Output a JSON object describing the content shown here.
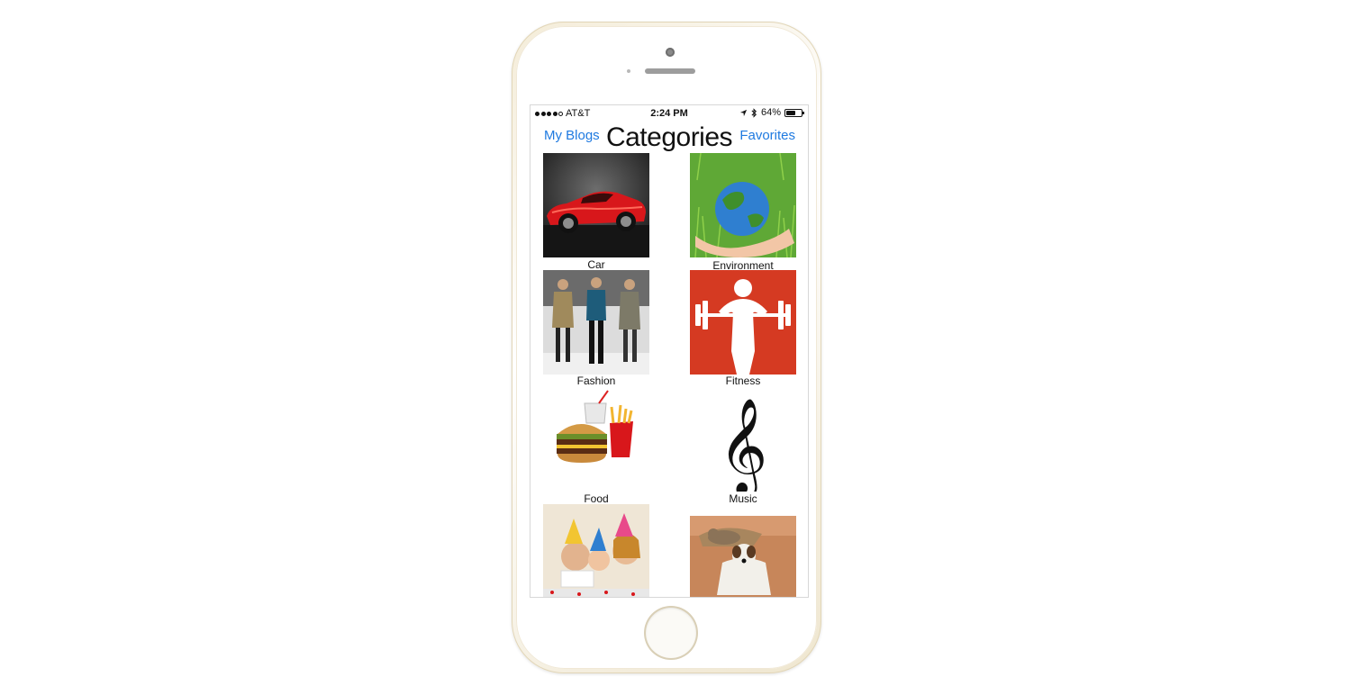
{
  "status_bar": {
    "carrier": "AT&T",
    "time": "2:24 PM",
    "battery_percent": "64%",
    "battery_level": 0.64
  },
  "nav": {
    "left_label": "My Blogs",
    "title": "Categories",
    "right_label": "Favorites"
  },
  "colors": {
    "link_blue": "#1f7ae0",
    "fitness_red": "#d53a22",
    "environment_green": "#5fa836",
    "car_red": "#d8171b"
  },
  "categories": [
    {
      "label": "Car",
      "icon": "car-icon"
    },
    {
      "label": "Environment",
      "icon": "globe-icon"
    },
    {
      "label": "Fashion",
      "icon": "fashion-icon"
    },
    {
      "label": "Fitness",
      "icon": "weightlifter-icon"
    },
    {
      "label": "Food",
      "icon": "burger-icon"
    },
    {
      "label": "Music",
      "icon": "treble-clef-icon"
    },
    {
      "label": "",
      "icon": "party-icon"
    },
    {
      "label": "",
      "icon": "pets-icon"
    }
  ]
}
